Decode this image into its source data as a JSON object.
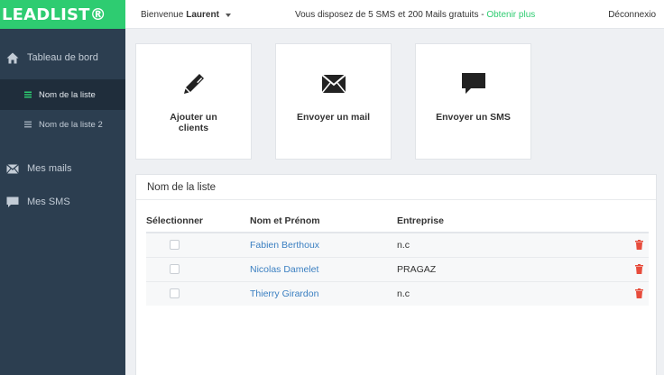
{
  "brand": {
    "logo": "LEADLIST®",
    "color": "#2ecc71"
  },
  "sidebar": {
    "items": [
      {
        "label": "Tableau de bord",
        "icon": "home-icon"
      },
      {
        "label": "Nom de la liste",
        "icon": "list-icon",
        "active": true
      },
      {
        "label": "Nom de la liste 2",
        "icon": "list-icon"
      },
      {
        "label": "Mes mails",
        "icon": "envelope-icon"
      },
      {
        "label": "Mes SMS",
        "icon": "chat-icon"
      }
    ]
  },
  "header": {
    "welcome_prefix": "Bienvenue",
    "username": "Laurent",
    "sms_message": "Vous disposez de 5 SMS et 200 Mails gratuits -",
    "sms_link": "Obtenir plus",
    "logout": "Déconnexio"
  },
  "cards": [
    {
      "label": "Ajouter un clients",
      "icon": "pencil-icon"
    },
    {
      "label": "Envoyer un mail",
      "icon": "envelope-icon"
    },
    {
      "label": "Envoyer un SMS",
      "icon": "chat-bubble-icon"
    }
  ],
  "list": {
    "title": "Nom de la liste",
    "columns": [
      "Sélectionner",
      "Nom et Prénom",
      "Entreprise"
    ],
    "rows": [
      {
        "name": "Fabien Berthoux",
        "company": "n.c"
      },
      {
        "name": "Nicolas Damelet",
        "company": "PRAGAZ"
      },
      {
        "name": "Thierry Girardon",
        "company": "n.c"
      }
    ]
  },
  "colors": {
    "accent": "#2ecc71",
    "sidebar": "#2c3e50",
    "link": "#3a7fc1",
    "danger": "#e74c3c"
  }
}
